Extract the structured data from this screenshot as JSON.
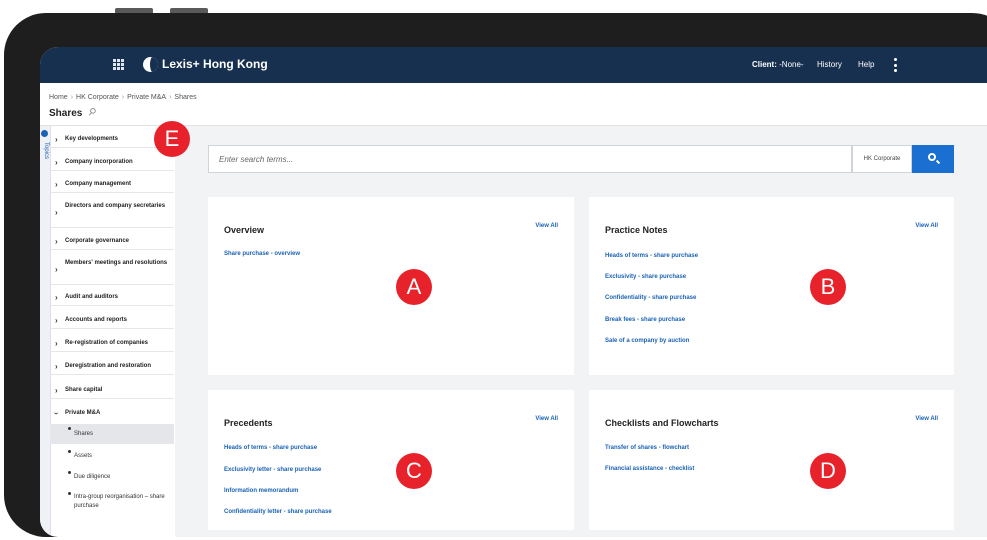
{
  "topbar": {
    "brand": "Lexis+ Hong Kong",
    "client_label": "Client:",
    "client_value": "-None-",
    "history": "History",
    "help": "Help"
  },
  "breadcrumb": [
    "Home",
    "HK Corporate",
    "Private M&A",
    "Shares"
  ],
  "page_title": "Shares",
  "rail_label": "Topics",
  "sidebar": {
    "items": [
      "Key developments",
      "Company incorporation",
      "Company management",
      "Directors and company secretaries",
      "Corporate governance",
      "Members' meetings and resolutions",
      "Audit and auditors",
      "Accounts and reports",
      "Re-registration of companies",
      "Deregistration and restoration",
      "Share capital",
      "Private M&A"
    ],
    "subitems": [
      "Shares",
      "Assets",
      "Due diligence",
      "Intra-group reorganisation – share purchase"
    ]
  },
  "search": {
    "placeholder": "Enter search terms...",
    "scope": "HK Corporate"
  },
  "cards": {
    "overview": {
      "title": "Overview",
      "view_all": "View All",
      "links": [
        "Share purchase - overview"
      ]
    },
    "practice_notes": {
      "title": "Practice Notes",
      "view_all": "View All",
      "links": [
        "Heads of terms - share purchase",
        "Exclusivity - share purchase",
        "Confidentiality - share purchase",
        "Break fees - share purchase",
        "Sale of a company by auction"
      ]
    },
    "precedents": {
      "title": "Precedents",
      "view_all": "View All",
      "links": [
        "Heads of terms - share purchase",
        "Exclusivity letter - share purchase",
        "Information memorandum",
        "Confidentiality letter - share purchase"
      ]
    },
    "checklists": {
      "title": "Checklists and Flowcharts",
      "view_all": "View All",
      "links": [
        "Transfer of shares - flowchart",
        "Financial assistance - checklist"
      ]
    }
  },
  "markers": [
    "A",
    "B",
    "C",
    "D",
    "E"
  ],
  "colors": {
    "topbar": "#17304f",
    "link": "#1a62b3",
    "accent_button": "#1a6fd0",
    "marker": "#e8222a",
    "panel_background": "#f2f3f5"
  }
}
